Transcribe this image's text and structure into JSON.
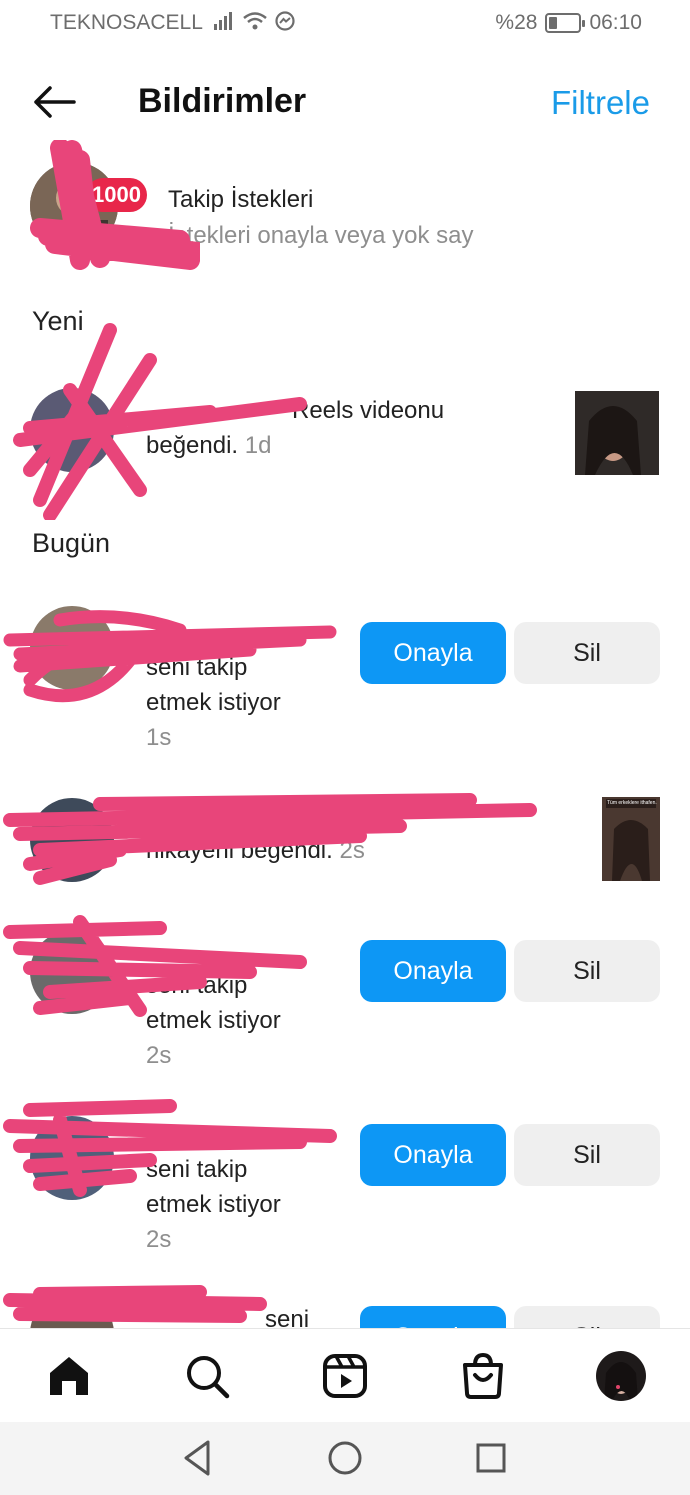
{
  "status_bar": {
    "carrier": "TEKNOSACELL",
    "battery_text": "%28",
    "battery_level": 0.28,
    "time": "06:10"
  },
  "header": {
    "title": "Bildirimler",
    "filter_label": "Filtrele"
  },
  "follow_requests": {
    "badge": "1000",
    "title": "Takip İstekleri",
    "subtitle": "İstekleri onayla veya yok say"
  },
  "sections": {
    "new": "Yeni",
    "today": "Bugün"
  },
  "new_items": [
    {
      "text": "Reels videonu",
      "text2": "beğendi.",
      "time": "1d"
    }
  ],
  "today_items": [
    {
      "text": "seni takip",
      "text2": "etmek istiyor",
      "time": "1s"
    },
    {
      "text": "hikayeni beğendi.",
      "time": "2s"
    },
    {
      "text": "seni takip",
      "text2": "etmek istiyor",
      "time": "2s"
    },
    {
      "text": "seni takip",
      "text2": "etmek istiyor",
      "time": "2s"
    },
    {
      "text": "seni"
    }
  ],
  "buttons": {
    "approve": "Onayla",
    "delete": "Sil"
  },
  "thumbnail_caption": "Tüm erkeklere ithafen.",
  "colors": {
    "accent": "#0d97f5",
    "link": "#1a9be8",
    "badge": "#e8264a",
    "redaction": "#e8457a"
  },
  "bottom_nav": [
    "home-icon",
    "search-icon",
    "reels-icon",
    "shop-icon",
    "profile-avatar"
  ],
  "system_nav": [
    "back-icon",
    "home-circle-icon",
    "recents-icon"
  ]
}
